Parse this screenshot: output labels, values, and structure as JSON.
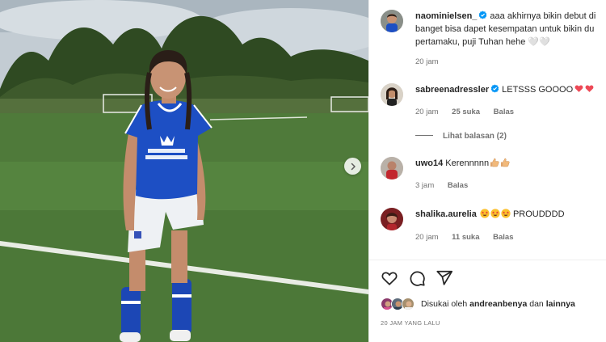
{
  "post": {
    "photo_alt": "",
    "next_button_label": ""
  },
  "comments": [
    {
      "username": "naominielsen_",
      "verified": true,
      "text_line1": "aaa akhirnya bikin debut di",
      "text_line2": "banget bisa dapet kesempatan untuk bikin du",
      "text_line3": "pertamaku, puji Tuhan hehe 🤍🤍",
      "time": "20 jam"
    },
    {
      "username": "sabreenadressler",
      "verified": true,
      "text": "LETSSS GOOOO",
      "time": "20 jam",
      "likes": "25 suka",
      "reply_label": "Balas",
      "view_replies": "Lihat balasan (2)"
    },
    {
      "username": "uwo14",
      "verified": false,
      "text": "Kerennnnn",
      "time": "3 jam",
      "reply_label": "Balas"
    },
    {
      "username": "shalika.aurelia",
      "verified": false,
      "text": "PROUDDDD",
      "time": "20 jam",
      "likes": "11 suka",
      "reply_label": "Balas"
    }
  ],
  "actions": {
    "like_icon": "heart-outline-icon",
    "comment_icon": "comment-bubble-icon",
    "share_icon": "paper-plane-icon"
  },
  "likes_summary": {
    "prefix": "Disukai oleh",
    "user": "andreanbenya",
    "conjunction": "dan",
    "others": "lainnya"
  },
  "timestamp": "20 JAM YANG LALU",
  "colors": {
    "verified_blue": "#0095f6",
    "heart_red": "#ed4956",
    "jersey_blue": "#1d4fc4",
    "grass_green": "#4f7a3a",
    "meta_gray": "#737373"
  }
}
